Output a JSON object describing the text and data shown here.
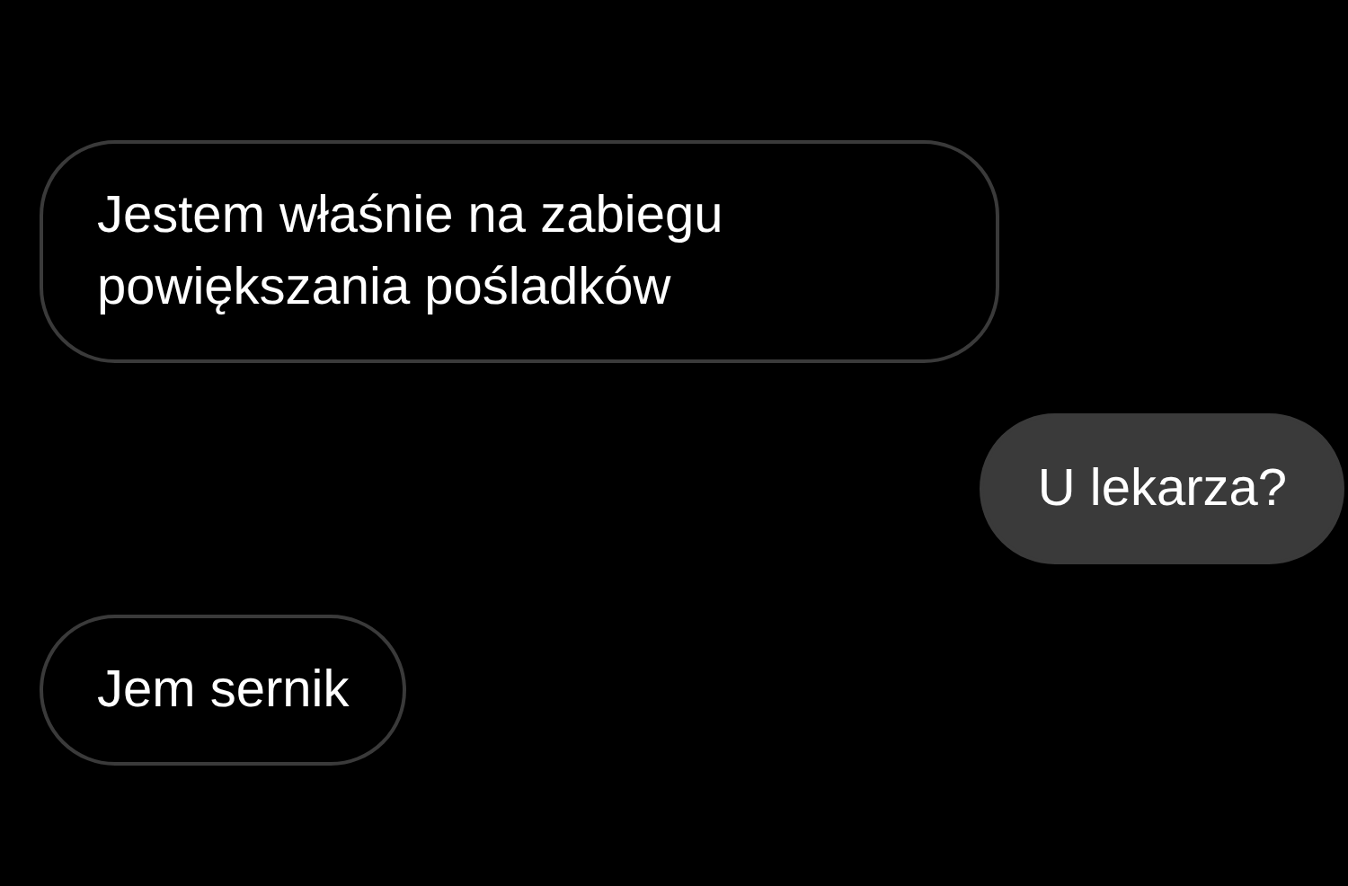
{
  "messages": [
    {
      "kind": "incoming",
      "text": "Jestem właśnie na zabiegu powiększania pośladków"
    },
    {
      "kind": "outgoing",
      "text": "U lekarza?"
    },
    {
      "kind": "incoming",
      "text": "Jem sernik"
    }
  ]
}
